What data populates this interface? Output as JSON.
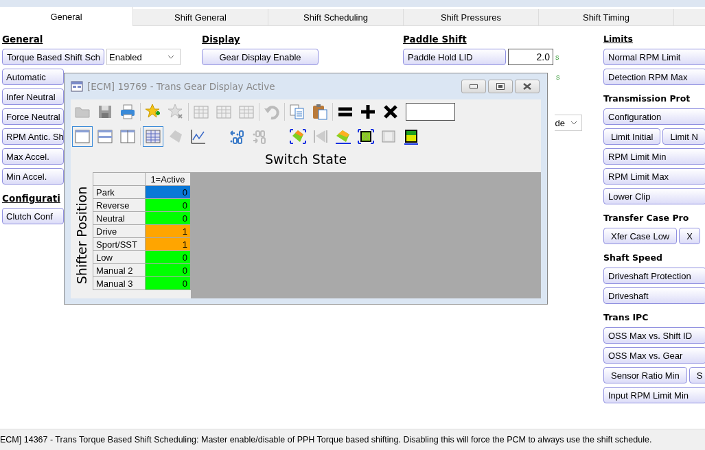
{
  "tabs": [
    {
      "label": "General",
      "selected": true
    },
    {
      "label": "Shift General",
      "selected": false
    },
    {
      "label": "Shift Scheduling",
      "selected": false
    },
    {
      "label": "Shift Pressures",
      "selected": false
    },
    {
      "label": "Shift Timing",
      "selected": false
    }
  ],
  "columns": [
    {
      "sections": [
        {
          "heading": "General",
          "underlined": true,
          "items": [
            {
              "kind": "select",
              "label": "Torque Based Shift Sch",
              "value": "Enabled"
            },
            {
              "kind": "button",
              "label": "Automatic"
            },
            {
              "kind": "button",
              "label": "Infer Neutral"
            },
            {
              "kind": "button",
              "label": "Force Neutral"
            },
            {
              "kind": "button",
              "label": "RPM Antic. Sh"
            },
            {
              "kind": "button",
              "label": "Max Accel."
            },
            {
              "kind": "button",
              "label": "Min Accel."
            }
          ]
        },
        {
          "heading": "Configurati",
          "underlined": true,
          "items": [
            {
              "kind": "button",
              "label": "Clutch Conf"
            }
          ]
        }
      ]
    },
    {
      "sections": [
        {
          "heading": "Display",
          "underlined": true,
          "items": [
            {
              "kind": "button",
              "label": "Gear Display Enable"
            }
          ]
        }
      ]
    },
    {
      "sections": [
        {
          "heading": "Paddle Shift",
          "underlined": true,
          "items": [
            {
              "kind": "number",
              "label": "Paddle Hold LID",
              "value": "2.0",
              "unit": "s"
            },
            {
              "kind": "unit",
              "unit": "s"
            },
            {
              "kind": "select",
              "value": "de"
            }
          ]
        }
      ]
    },
    {
      "sections": [
        {
          "heading": "Limits",
          "underlined": true,
          "items": [
            {
              "kind": "button",
              "label": "Normal RPM Limit"
            },
            {
              "kind": "button",
              "label": "Detection RPM Max"
            }
          ]
        },
        {
          "heading": "Transmission Prot",
          "underlined": false,
          "items": [
            {
              "kind": "button",
              "label": "Configuration"
            },
            {
              "kind": "pair",
              "labels": [
                "Limit Initial",
                "Limit N"
              ]
            },
            {
              "kind": "button",
              "label": "RPM Limit Min"
            },
            {
              "kind": "button",
              "label": "RPM Limit Max"
            },
            {
              "kind": "button",
              "label": "Lower Clip"
            }
          ]
        },
        {
          "heading": "Transfer Case Pro",
          "underlined": false,
          "items": [
            {
              "kind": "pair",
              "labels": [
                "Xfer Case Low",
                "X"
              ]
            }
          ]
        },
        {
          "heading": "Shaft Speed",
          "underlined": false,
          "items": [
            {
              "kind": "button",
              "label": "Driveshaft Protection"
            },
            {
              "kind": "button",
              "label": "Driveshaft"
            }
          ]
        },
        {
          "heading": "Trans IPC",
          "underlined": false,
          "items": [
            {
              "kind": "button",
              "label": "OSS Max vs. Shift ID"
            },
            {
              "kind": "button",
              "label": "OSS Max vs. Gear"
            },
            {
              "kind": "pair",
              "labels": [
                "Sensor Ratio Min",
                "S"
              ]
            },
            {
              "kind": "button",
              "label": "Input RPM Limit Min"
            }
          ]
        }
      ]
    }
  ],
  "table_window": {
    "title": "[ECM] 19769 - Trans Gear Display Active",
    "heading": "Switch State",
    "axis_label": "Shifter Position",
    "column_header": "1=Active",
    "rows": [
      {
        "name": "Park",
        "value": "0",
        "color": "#0a78d7"
      },
      {
        "name": "Reverse",
        "value": "0",
        "color": "#00ff00"
      },
      {
        "name": "Neutral",
        "value": "0",
        "color": "#00ff00"
      },
      {
        "name": "Drive",
        "value": "1",
        "color": "#ffa500"
      },
      {
        "name": "Sport/SST",
        "value": "1",
        "color": "#ffa500"
      },
      {
        "name": "Low",
        "value": "0",
        "color": "#00ff00"
      },
      {
        "name": "Manual 2",
        "value": "0",
        "color": "#00ff00"
      },
      {
        "name": "Manual 3",
        "value": "0",
        "color": "#00ff00"
      }
    ]
  },
  "status_bar": "ECM] 14367 - Trans Torque Based Shift Scheduling: Master enable/disable of PPH Torque based shifting.  Disabling this will force the PCM to always use the shift schedule."
}
